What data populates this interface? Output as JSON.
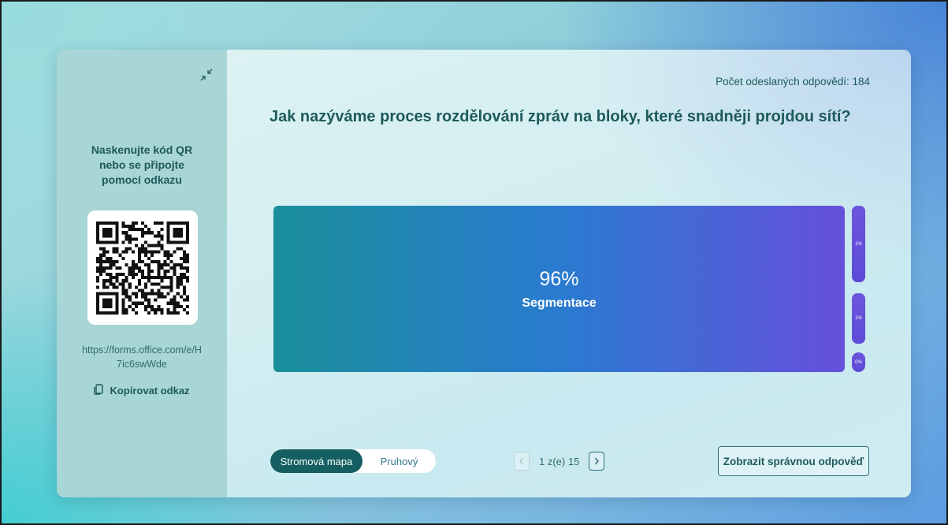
{
  "sidebar": {
    "scan_instructions": "Naskenujte kód QR nebo se připojte pomocí odkazu",
    "link": "https://forms.office.com/e/H7ic6swWde",
    "copy_label": "Kopírovat odkaz",
    "collapse_icon": "collapse-arrows-icon",
    "copy_icon": "copy-icon"
  },
  "main": {
    "response_count": "Počet odeslaných odpovědí: 184",
    "question": "Jak nazýváme proces rozdělování zpráv na bloky, které snadněji projdou sítí?",
    "results": [
      {
        "percent": "96%",
        "label": "Segmentace",
        "share": 0.96
      },
      {
        "percent": "1%",
        "label": "",
        "share": 0.01
      },
      {
        "percent": "1%",
        "label": "",
        "share": 0.01
      },
      {
        "percent": "0%",
        "label": "",
        "share": 0.0
      }
    ]
  },
  "footer": {
    "view_toggle": {
      "active": "Stromová mapa",
      "inactive": "Pruhový"
    },
    "pager": {
      "text": "1 z(e) 15",
      "current": 1,
      "total": 15
    },
    "show_answer": "Zobrazit správnou odpověď"
  },
  "colors": {
    "accent": "#155f62",
    "tile_start": "#1a8f9a",
    "tile_mid": "#2a7bd0",
    "tile_end": "#6650dc",
    "sidebar_bg": "#a8d5d5"
  }
}
